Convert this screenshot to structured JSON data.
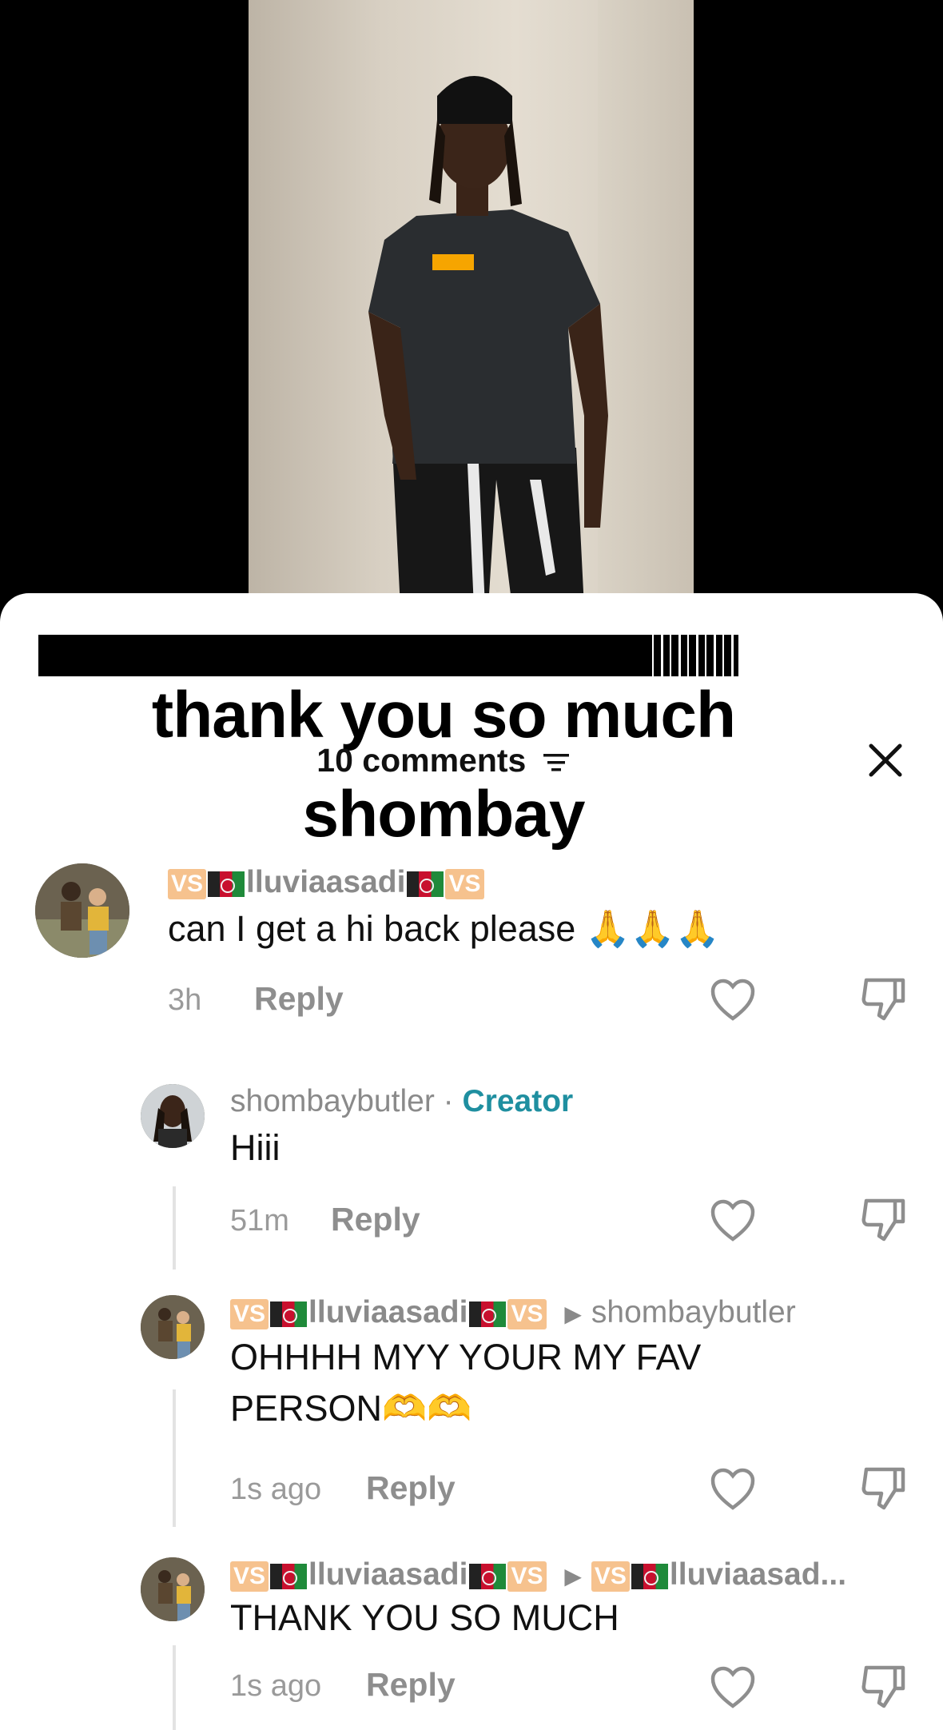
{
  "overlay": {
    "line1": "thank you so much",
    "line2": "shombay"
  },
  "header": {
    "comment_count": "10 comments",
    "sort_icon": "sort-icon",
    "close_icon": "close-icon"
  },
  "comments": [
    {
      "user": "lluviaasadi",
      "badge": "VS",
      "text": "can I get a hi back please 🙏🙏🙏",
      "time": "3h",
      "reply_label": "Reply"
    },
    {
      "user": "shombaybutler",
      "separator": "·",
      "creator_label": "Creator",
      "text": "Hiii",
      "time": "51m",
      "reply_label": "Reply"
    },
    {
      "user": "lluviaasadi",
      "badge": "VS",
      "reply_to": "shombaybutler",
      "text": "OHHHH MYY YOUR MY FAV PERSON🫶🫶",
      "time": "1s ago",
      "reply_label": "Reply"
    },
    {
      "user": "lluviaasadi",
      "badge": "VS",
      "reply_to": "lluviaasad...",
      "text": "THANK YOU SO MUCH",
      "time": "1s ago",
      "reply_label": "Reply"
    }
  ],
  "colors": {
    "creator": "#1f8fa0",
    "muted": "#8a8a8a",
    "badge": "#f6c28e"
  }
}
